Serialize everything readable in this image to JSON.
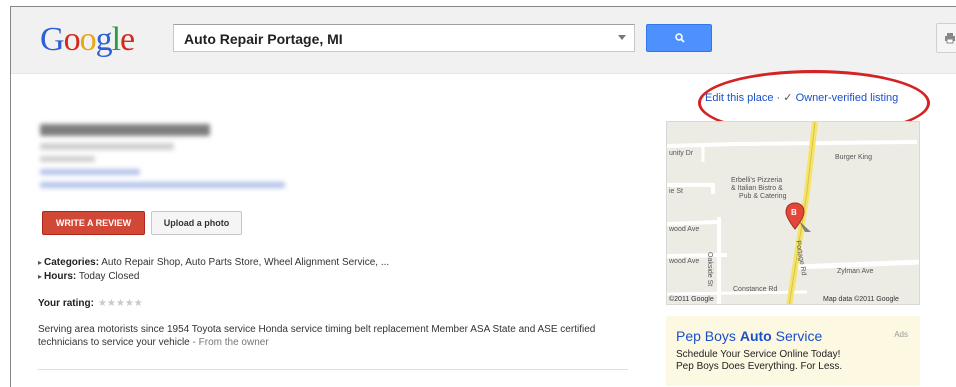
{
  "logo": {
    "letters": [
      "G",
      "o",
      "o",
      "g",
      "l",
      "e"
    ],
    "colors": [
      "#2d5fd6",
      "#d32a1e",
      "#e6a81b",
      "#2d5fd6",
      "#2a9a3a",
      "#d32a1e"
    ]
  },
  "search": {
    "value": "Auto Repair Portage, MI",
    "button_icon": "search-icon"
  },
  "top_links": {
    "edit": "Edit this place",
    "separator": "·",
    "check": "✓",
    "owner": "Owner-verified listing"
  },
  "buttons": {
    "review": "WRITE A REVIEW",
    "upload": "Upload a photo"
  },
  "details": {
    "categories_label": "Categories:",
    "categories_value": "Auto Repair Shop, Auto Parts Store, Wheel Alignment Service, ...",
    "hours_label": "Hours:",
    "hours_value": "Today  Closed",
    "rating_label": "Your rating:",
    "stars": "★★★★★"
  },
  "description": {
    "text": "Serving area motorists since 1954 Toyota service Honda service timing belt replacement Member ASA State and ASE certified technicians to service your vehicle",
    "owner": " - From the owner"
  },
  "map": {
    "labels": {
      "unity": "unity Dr",
      "burger": "Burger King",
      "erbelli": "Erbelli's Pizzeria",
      "italian": "& Italian Bistro &",
      "pub": "Pub & Catering",
      "ie": "ie St",
      "wood1": "wood Ave",
      "wood2": "wood Ave",
      "oakside": "Oakside St",
      "portage": "Portage Rd",
      "zylman": "Zylman Ave",
      "constance": "Constance Rd",
      "copyright": "©2011 Google",
      "mapdata": "Map data ©2011 Google",
      "marker": "B"
    },
    "colors": {
      "road": "#ffffff",
      "highway": "#f5e46a",
      "marker": "#e3473a"
    }
  },
  "ad": {
    "title_pre": "Pep Boys ",
    "title_bold": "Auto",
    "title_post": " Service",
    "label": "Ads",
    "line1": "Schedule Your Service Online Today!",
    "line2": "Pep Boys Does Everything. For Less."
  }
}
